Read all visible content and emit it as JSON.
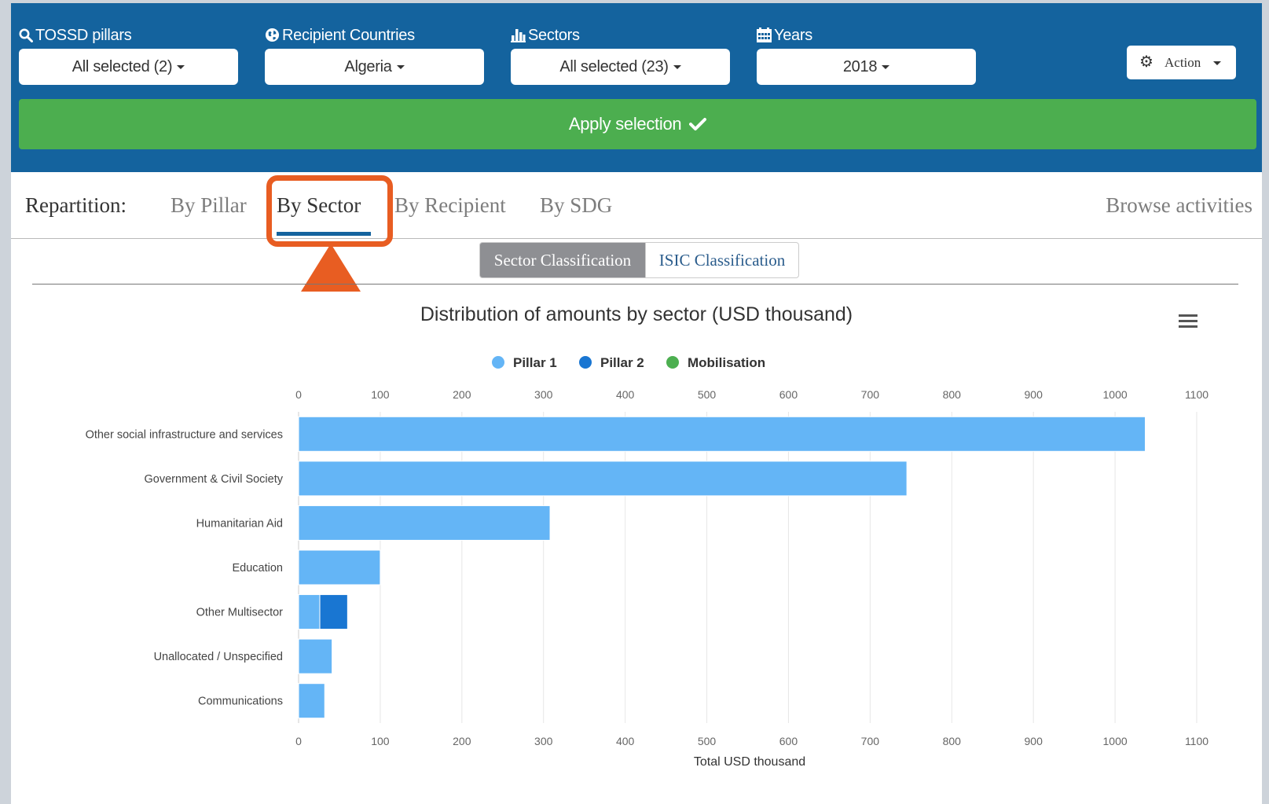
{
  "filters": [
    {
      "label": "TOSSD pillars",
      "icon": "search-icon",
      "value": "All selected (2)"
    },
    {
      "label": "Recipient Countries",
      "icon": "globe-icon",
      "value": "Algeria"
    },
    {
      "label": "Sectors",
      "icon": "bar-chart-icon",
      "value": "All selected (23)"
    },
    {
      "label": "Years",
      "icon": "calendar-icon",
      "value": "2018"
    }
  ],
  "action": {
    "label": "Action",
    "icon": "gear-icon"
  },
  "apply": {
    "label": "Apply selection",
    "icon": "check-icon"
  },
  "tabs": {
    "repartition": "Repartition:",
    "items": [
      "By Pillar",
      "By Sector",
      "By Recipient",
      "By SDG"
    ],
    "active": "By Sector",
    "browse": "Browse activities"
  },
  "subtabs": {
    "items": [
      "Sector Classification",
      "ISIC Classification"
    ],
    "active": "Sector Classification"
  },
  "colors": {
    "header": "#14639e",
    "apply": "#4cae4f",
    "highlight": "#e85d22",
    "pillar1": "#64b5f6",
    "pillar2": "#1976d2",
    "mobilisation": "#4caf50"
  },
  "chart_data": {
    "type": "bar",
    "orientation": "horizontal",
    "stacked": true,
    "title": "Distribution of amounts by sector (USD thousand)",
    "xlabel": "Total USD thousand",
    "xlim": [
      0,
      1100
    ],
    "ticks": [
      0,
      100,
      200,
      300,
      400,
      500,
      600,
      700,
      800,
      900,
      1000,
      1100
    ],
    "grid": true,
    "legend_position": "top-center",
    "menu_icon": "hamburger-menu-icon",
    "categories": [
      "Other social infrastructure and services",
      "Government & Civil Society",
      "Humanitarian Aid",
      "Education",
      "Other Multisector",
      "Unallocated / Unspecified",
      "Communications"
    ],
    "series": [
      {
        "name": "Pillar 1",
        "color": "#64b5f6",
        "values": [
          1037,
          745,
          308,
          100,
          26,
          41,
          32
        ]
      },
      {
        "name": "Pillar 2",
        "color": "#1976d2",
        "values": [
          0,
          0,
          0,
          0,
          34,
          0,
          0
        ]
      },
      {
        "name": "Mobilisation",
        "color": "#4caf50",
        "values": [
          0,
          0,
          0,
          0,
          0,
          0,
          0
        ]
      }
    ]
  }
}
